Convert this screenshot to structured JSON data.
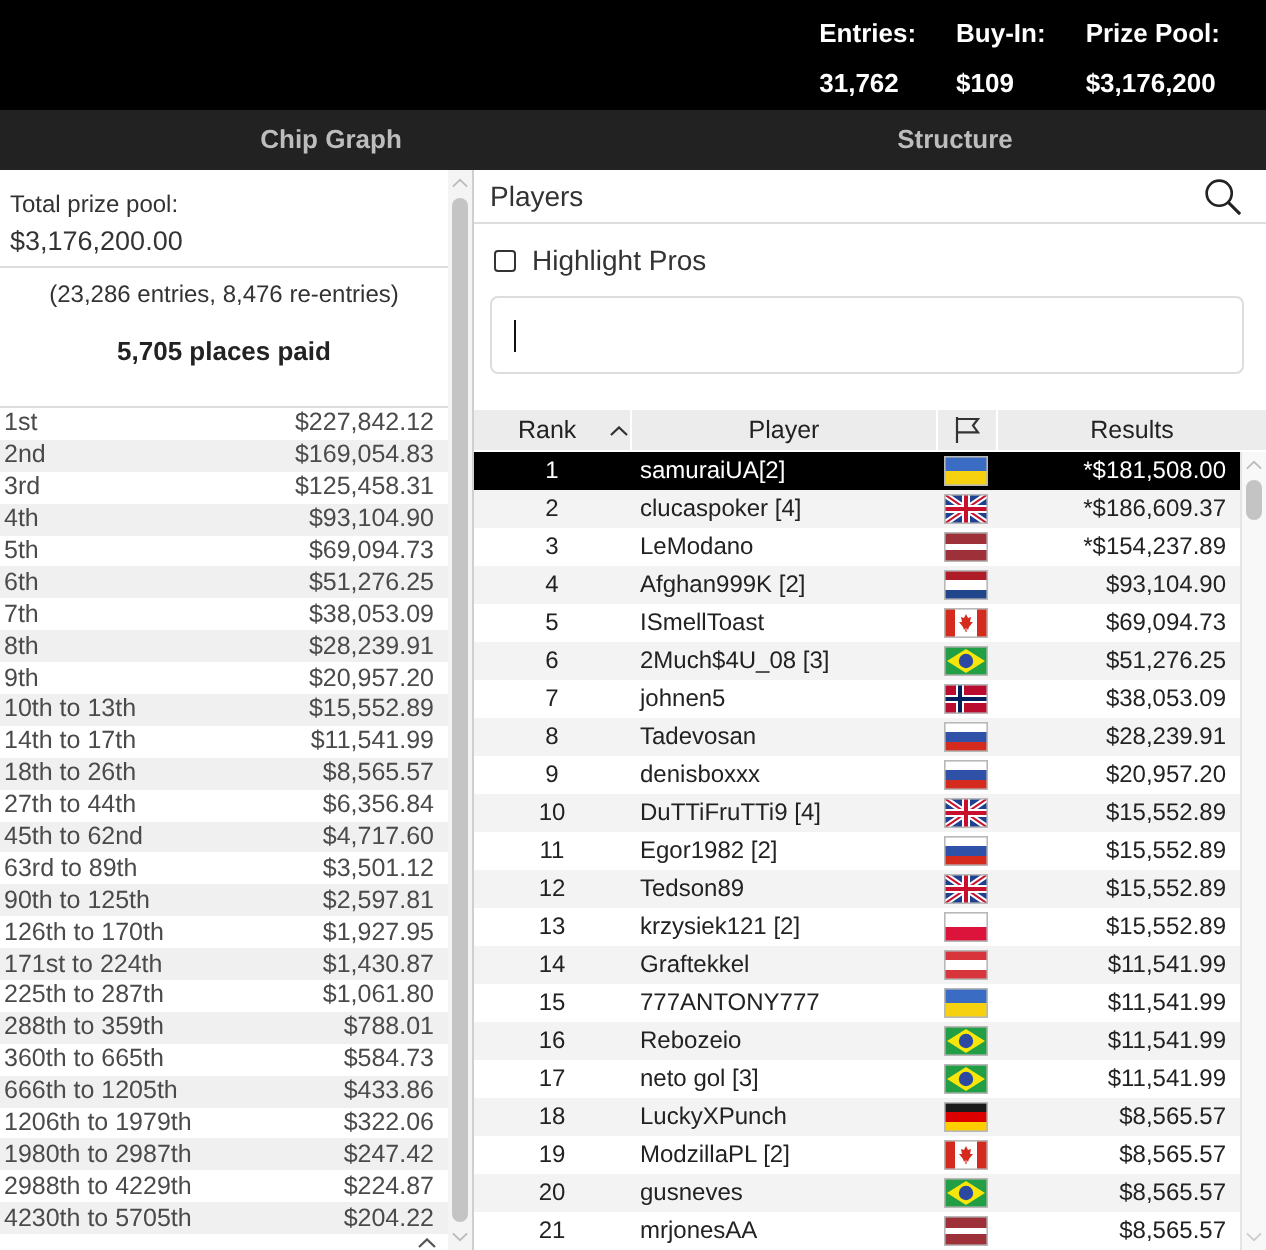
{
  "header": {
    "stats": [
      {
        "label": "Entries:",
        "value": "31,762"
      },
      {
        "label": "Buy-In:",
        "value": "$109"
      },
      {
        "label": "Prize Pool:",
        "value": "$3,176,200"
      }
    ]
  },
  "tabs": [
    {
      "label": "Chip Graph",
      "selected": false
    },
    {
      "label": "Structure",
      "selected": false
    }
  ],
  "payouts": {
    "total_label": "Total prize pool:",
    "total_value": "$3,176,200.00",
    "entries_note": "(23,286 entries, 8,476 re-entries)",
    "places_paid": "5,705 places paid",
    "rows": [
      {
        "place": "1st",
        "prize": "$227,842.12"
      },
      {
        "place": "2nd",
        "prize": "$169,054.83"
      },
      {
        "place": "3rd",
        "prize": "$125,458.31"
      },
      {
        "place": "4th",
        "prize": "$93,104.90"
      },
      {
        "place": "5th",
        "prize": "$69,094.73"
      },
      {
        "place": "6th",
        "prize": "$51,276.25"
      },
      {
        "place": "7th",
        "prize": "$38,053.09"
      },
      {
        "place": "8th",
        "prize": "$28,239.91"
      },
      {
        "place": "9th",
        "prize": "$20,957.20"
      },
      {
        "place": "10th to 13th",
        "prize": "$15,552.89"
      },
      {
        "place": "14th to 17th",
        "prize": "$11,541.99"
      },
      {
        "place": "18th to 26th",
        "prize": "$8,565.57"
      },
      {
        "place": "27th to 44th",
        "prize": "$6,356.84"
      },
      {
        "place": "45th to 62nd",
        "prize": "$4,717.60"
      },
      {
        "place": "63rd to 89th",
        "prize": "$3,501.12"
      },
      {
        "place": "90th to 125th",
        "prize": "$2,597.81"
      },
      {
        "place": "126th to 170th",
        "prize": "$1,927.95"
      },
      {
        "place": "171st to 224th",
        "prize": "$1,430.87"
      },
      {
        "place": "225th to 287th",
        "prize": "$1,061.80"
      },
      {
        "place": "288th to 359th",
        "prize": "$788.01"
      },
      {
        "place": "360th to 665th",
        "prize": "$584.73"
      },
      {
        "place": "666th to 1205th",
        "prize": "$433.86"
      },
      {
        "place": "1206th to 1979th",
        "prize": "$322.06"
      },
      {
        "place": "1980th to 2987th",
        "prize": "$247.42"
      },
      {
        "place": "2988th to 4229th",
        "prize": "$224.87"
      },
      {
        "place": "4230th to 5705th",
        "prize": "$204.22"
      }
    ]
  },
  "players": {
    "title": "Players",
    "highlight_pros": {
      "label": "Highlight Pros",
      "checked": false
    },
    "table": {
      "columns": [
        {
          "kind": "text",
          "label": "Rank",
          "sorted": true
        },
        {
          "kind": "text",
          "label": "Player",
          "sorted": false
        },
        {
          "kind": "flag",
          "sorted": false
        },
        {
          "kind": "text",
          "label": "Results",
          "sorted": false
        }
      ],
      "rows": [
        {
          "rank": "1",
          "player": "samuraiUA[2]",
          "kind": "ukraine",
          "result": "*$181,508.00",
          "selected": true
        },
        {
          "rank": "2",
          "player": "clucaspoker [4]",
          "kind": "uk",
          "result": "*$186,609.37",
          "selected": false
        },
        {
          "rank": "3",
          "player": "LeModano",
          "kind": "latvia",
          "result": "*$154,237.89",
          "selected": false
        },
        {
          "rank": "4",
          "player": "Afghan999K [2]",
          "kind": "netherlands",
          "result": "$93,104.90",
          "selected": false
        },
        {
          "rank": "5",
          "player": "ISmellToast",
          "kind": "canada",
          "result": "$69,094.73",
          "selected": false
        },
        {
          "rank": "6",
          "player": "2Much$4U_08 [3]",
          "kind": "brazil",
          "result": "$51,276.25",
          "selected": false
        },
        {
          "rank": "7",
          "player": "johnen5",
          "kind": "norway",
          "result": "$38,053.09",
          "selected": false
        },
        {
          "rank": "8",
          "player": "Tadevosan",
          "kind": "russia",
          "result": "$28,239.91",
          "selected": false
        },
        {
          "rank": "9",
          "player": "denisboxxx",
          "kind": "russia",
          "result": "$20,957.20",
          "selected": false
        },
        {
          "rank": "10",
          "player": "DuTTiFruTTi9 [4]",
          "kind": "uk",
          "result": "$15,552.89",
          "selected": false
        },
        {
          "rank": "11",
          "player": "Egor1982 [2]",
          "kind": "russia",
          "result": "$15,552.89",
          "selected": false
        },
        {
          "rank": "12",
          "player": "Tedson89",
          "kind": "uk",
          "result": "$15,552.89",
          "selected": false
        },
        {
          "rank": "13",
          "player": "krzysiek121 [2]",
          "kind": "poland",
          "result": "$15,552.89",
          "selected": false
        },
        {
          "rank": "14",
          "player": "Graftekkel",
          "kind": "austria",
          "result": "$11,541.99",
          "selected": false
        },
        {
          "rank": "15",
          "player": "777ANTONY777",
          "kind": "ukraine",
          "result": "$11,541.99",
          "selected": false
        },
        {
          "rank": "16",
          "player": "Rebozeio",
          "kind": "brazil",
          "result": "$11,541.99",
          "selected": false
        },
        {
          "rank": "17",
          "player": "neto gol [3]",
          "kind": "brazil",
          "result": "$11,541.99",
          "selected": false
        },
        {
          "rank": "18",
          "player": "LuckyXPunch",
          "kind": "germany",
          "result": "$8,565.57",
          "selected": false
        },
        {
          "rank": "19",
          "player": "ModzillaPL [2]",
          "kind": "canada",
          "result": "$8,565.57",
          "selected": false
        },
        {
          "rank": "20",
          "player": "gusneves",
          "kind": "brazil",
          "result": "$8,565.57",
          "selected": false
        },
        {
          "rank": "21",
          "player": "mrjonesAA",
          "kind": "latvia",
          "result": "$8,565.57",
          "selected": false
        }
      ]
    }
  }
}
